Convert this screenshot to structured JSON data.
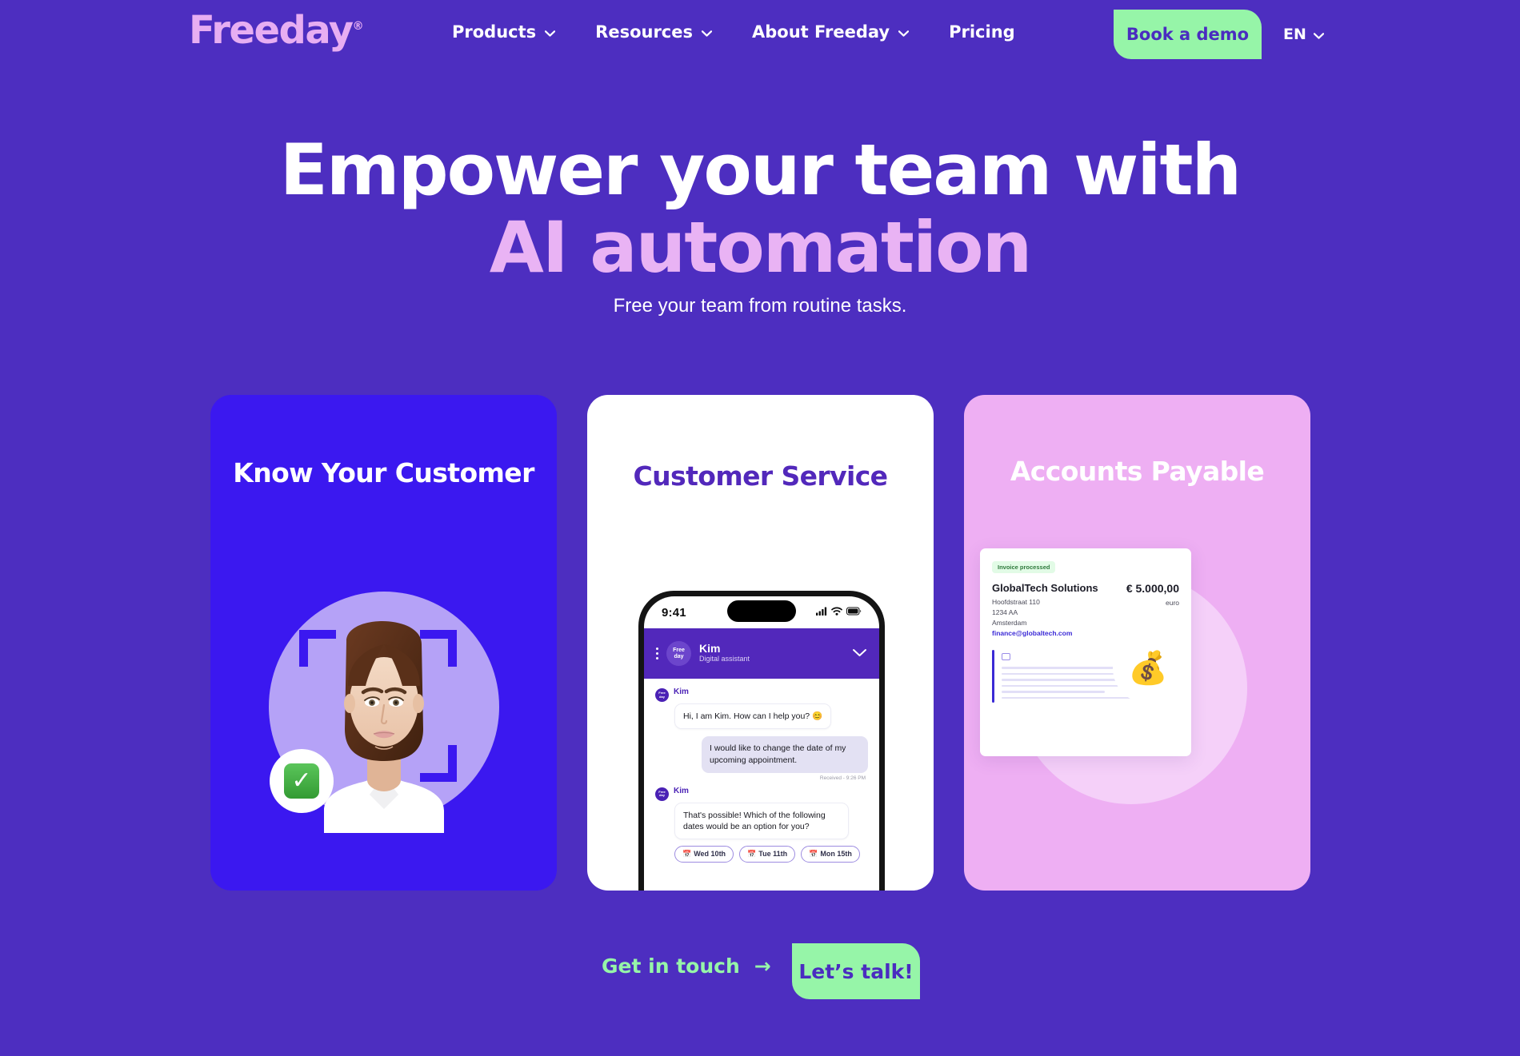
{
  "brand": {
    "logo_text": "Freeday",
    "registered_mark": "®",
    "logo_color": "#e7aef2",
    "background_color": "#4d2ec0",
    "accent_green": "#96f5a8",
    "accent_pink": "#e9b3f4"
  },
  "nav": {
    "items": [
      {
        "label": "Products",
        "has_dropdown": true
      },
      {
        "label": "Resources",
        "has_dropdown": true
      },
      {
        "label": "About Freeday",
        "has_dropdown": true
      },
      {
        "label": "Pricing",
        "has_dropdown": false
      }
    ],
    "book_demo_label": "Book a demo",
    "language": "EN"
  },
  "hero": {
    "title_line1": "Empower your team with",
    "title_line2": "AI automation",
    "subtitle": "Free your team from routine tasks."
  },
  "cards": {
    "kyc": {
      "title": "Know Your Customer",
      "background_color": "#3b18f0",
      "check_icon": "✓"
    },
    "customer_service": {
      "title": "Customer Service",
      "background_color": "#ffffff",
      "title_color": "#5228bb",
      "phone": {
        "status_time": "9:41",
        "header": {
          "avatar_line1": "Free",
          "avatar_line2": "day",
          "name": "Kim",
          "role": "Digital assistant"
        },
        "messages": [
          {
            "sender": "Kim",
            "direction": "in",
            "text": "Hi, I am Kim. How can I help you? 😊",
            "meta": ""
          },
          {
            "sender": "",
            "direction": "out",
            "text": "I would like to change the date of my upcoming appointment.",
            "meta": "Received - 9:26 PM"
          },
          {
            "sender": "Kim",
            "direction": "in",
            "text": "That's possible! Which of the following dates would be an option for you?",
            "meta": ""
          }
        ],
        "date_chips": [
          {
            "emoji": "📅",
            "label": "Wed 10th"
          },
          {
            "emoji": "📅",
            "label": "Tue 11th"
          },
          {
            "emoji": "📅",
            "label": "Mon 15th"
          }
        ]
      }
    },
    "accounts_payable": {
      "title": "Accounts Payable",
      "background_color": "#eeaff3",
      "invoice": {
        "status_badge": "Invoice processed",
        "company": "GlobalTech Solutions",
        "address_line1": "Hoofdstraat 110",
        "address_line2": "1234 AA",
        "address_line3": "Amsterdam",
        "email": "finance@globaltech.com",
        "amount": "€ 5.000,00",
        "currency": "euro"
      },
      "money_icon": "💰"
    }
  },
  "cta": {
    "link_label": "Get in touch",
    "link_arrow": "→",
    "button_label": "Let’s talk!"
  }
}
